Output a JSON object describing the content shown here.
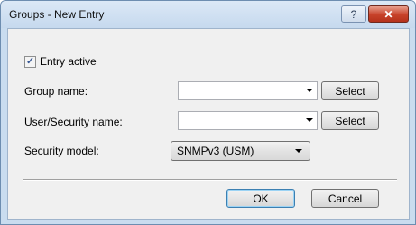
{
  "window": {
    "title": "Groups - New Entry",
    "help_label": "?",
    "close_label": "✕"
  },
  "form": {
    "entry_active": {
      "label": "Entry active",
      "checked": true,
      "check_glyph": "✓"
    },
    "group_name": {
      "label": "Group name:",
      "value": "",
      "select_label": "Select"
    },
    "user_security_name": {
      "label": "User/Security name:",
      "value": "",
      "select_label": "Select"
    },
    "security_model": {
      "label": "Security model:",
      "value": "SNMPv3 (USM)"
    }
  },
  "buttons": {
    "ok": "OK",
    "cancel": "Cancel"
  }
}
